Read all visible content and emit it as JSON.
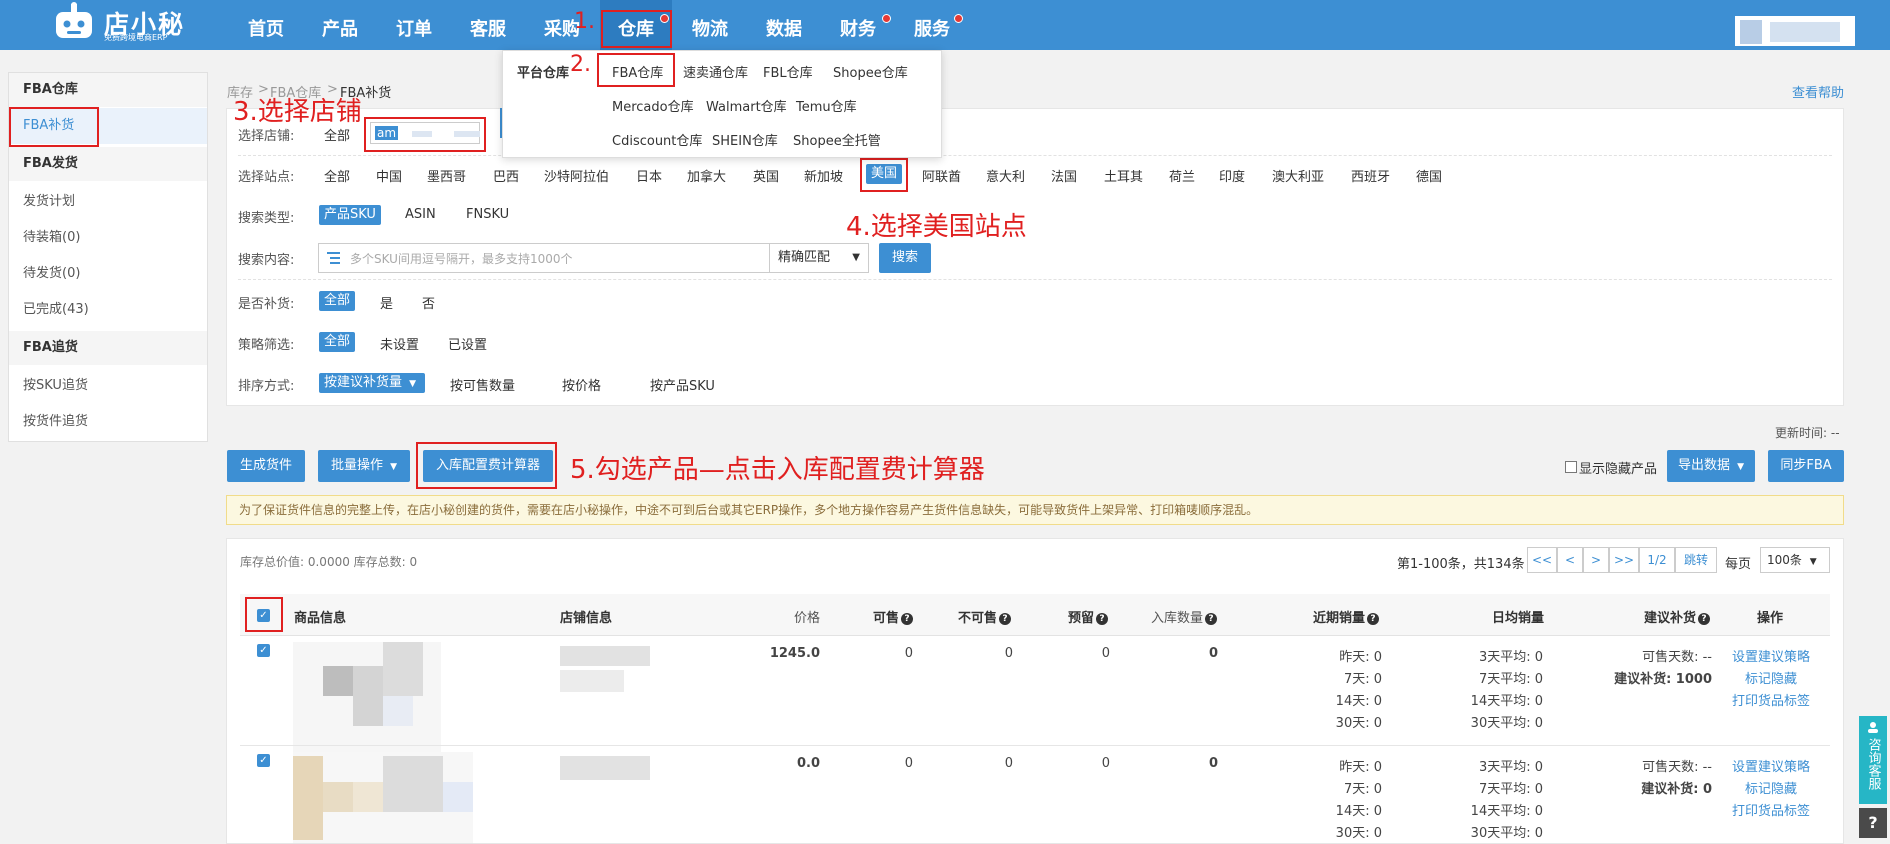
{
  "brand": {
    "title": "店小秘",
    "subtitle": "免费跨境电商ERP"
  },
  "nav": [
    "首页",
    "产品",
    "订单",
    "客服",
    "采购",
    "仓库",
    "物流",
    "数据",
    "财务",
    "服务"
  ],
  "dropdown": {
    "group": "平台仓库",
    "items": [
      "FBA仓库",
      "速卖通仓库",
      "FBL仓库",
      "Shopee仓库",
      "Mercado仓库",
      "Walmart仓库",
      "Temu仓库",
      "Cdiscount仓库",
      "SHEIN仓库",
      "Shopee全托管"
    ]
  },
  "sidebar": {
    "sections": [
      {
        "title": "FBA仓库",
        "items": [
          "FBA补货"
        ]
      },
      {
        "title": "FBA发货",
        "items": [
          "发货计划",
          "待装箱(0)",
          "待发货(0)",
          "已完成(43)"
        ]
      },
      {
        "title": "FBA追货",
        "items": [
          "按SKU追货",
          "按货件追货"
        ]
      }
    ]
  },
  "breadcrumb": [
    "库存",
    ">",
    "FBA仓库",
    ">",
    "FBA补货"
  ],
  "help": "查看帮助",
  "filters": {
    "shop": {
      "label": "选择店铺:",
      "all": "全部",
      "value": "am"
    },
    "site": {
      "label": "选择站点:",
      "options": [
        "全部",
        "中国",
        "墨西哥",
        "巴西",
        "沙特阿拉伯",
        "日本",
        "加拿大",
        "英国",
        "新加坡",
        "美国",
        "阿联酋",
        "意大利",
        "法国",
        "土耳其",
        "荷兰",
        "印度",
        "澳大利亚",
        "西班牙",
        "德国"
      ],
      "selected": "美国"
    },
    "search_type": {
      "label": "搜索类型:",
      "options": [
        "产品SKU",
        "ASIN",
        "FNSKU"
      ],
      "selected": "产品SKU"
    },
    "search": {
      "label": "搜索内容:",
      "placeholder": "多个SKU间用逗号隔开，最多支持1000个",
      "match": "精确匹配",
      "button": "搜索"
    },
    "replenish": {
      "label": "是否补货:",
      "options": [
        "全部",
        "是",
        "否"
      ],
      "selected": "全部"
    },
    "strategy": {
      "label": "策略筛选:",
      "options": [
        "全部",
        "未设置",
        "已设置"
      ],
      "selected": "全部"
    },
    "sort": {
      "label": "排序方式:",
      "options": [
        "按建议补货量",
        "按可售数量",
        "按价格",
        "按产品SKU"
      ],
      "selected": "按建议补货量"
    }
  },
  "annotations": [
    "1.",
    "2.",
    "3.选择店铺",
    "4.选择美国站点",
    "5.勾选产品—点击入库配置费计算器"
  ],
  "toolbar": {
    "generate": "生成货件",
    "batch": "批量操作",
    "calculator": "入库配置费计算器",
    "show_hidden": "显示隐藏产品",
    "export": "导出数据",
    "sync": "同步FBA",
    "update_time": "更新时间: --"
  },
  "notice": "为了保证货件信息的完整上传，在店小秘创建的货件，需要在店小秘操作，中途不可到后台或其它ERP操作，多个地方操作容易产生货件信息缺失，可能导致货件上架异常、打印箱唛顺序混乱。",
  "summary": "库存总价值: 0.0000 库存总数: 0",
  "pagination": {
    "info": "第1-100条，共134条",
    "first": "<<",
    "prev": "<",
    "next": ">",
    "last": ">>",
    "page": "1/2",
    "jump": "跳转",
    "per_page_label": "每页",
    "per_page": "100条"
  },
  "table": {
    "headers": [
      "商品信息",
      "店铺信息",
      "价格",
      "可售",
      "不可售",
      "预留",
      "入库数量",
      "近期销量",
      "日均销量",
      "建议补货",
      "操作"
    ],
    "rows": [
      {
        "price": "1245.0",
        "sellable": "0",
        "unsellable": "0",
        "reserved": "0",
        "inbound": "0",
        "recent": [
          "昨天: 0",
          "7天: 0",
          "14天: 0",
          "30天: 0"
        ],
        "daily": [
          "3天平均: 0",
          "7天平均: 0",
          "14天平均: 0",
          "30天平均: 0"
        ],
        "suggest": [
          "可售天数: --",
          "建议补货: 1000"
        ],
        "actions": [
          "设置建议策略",
          "标记隐藏",
          "打印货品标签"
        ]
      },
      {
        "price": "0.0",
        "sellable": "0",
        "unsellable": "0",
        "reserved": "0",
        "inbound": "0",
        "recent": [
          "昨天: 0",
          "7天: 0",
          "14天: 0",
          "30天: 0"
        ],
        "daily": [
          "3天平均: 0",
          "7天平均: 0",
          "14天平均: 0",
          "30天平均: 0"
        ],
        "suggest": [
          "可售天数: --",
          "建议补货: 0"
        ],
        "actions": [
          "设置建议策略",
          "标记隐藏",
          "打印货品标签"
        ]
      }
    ]
  },
  "float": {
    "kefu": "咨询客服",
    "help": "?"
  },
  "colors": {
    "primary": "#3d8fd3",
    "annotation": "#e02020",
    "notice_bg": "#fcf8e0"
  }
}
